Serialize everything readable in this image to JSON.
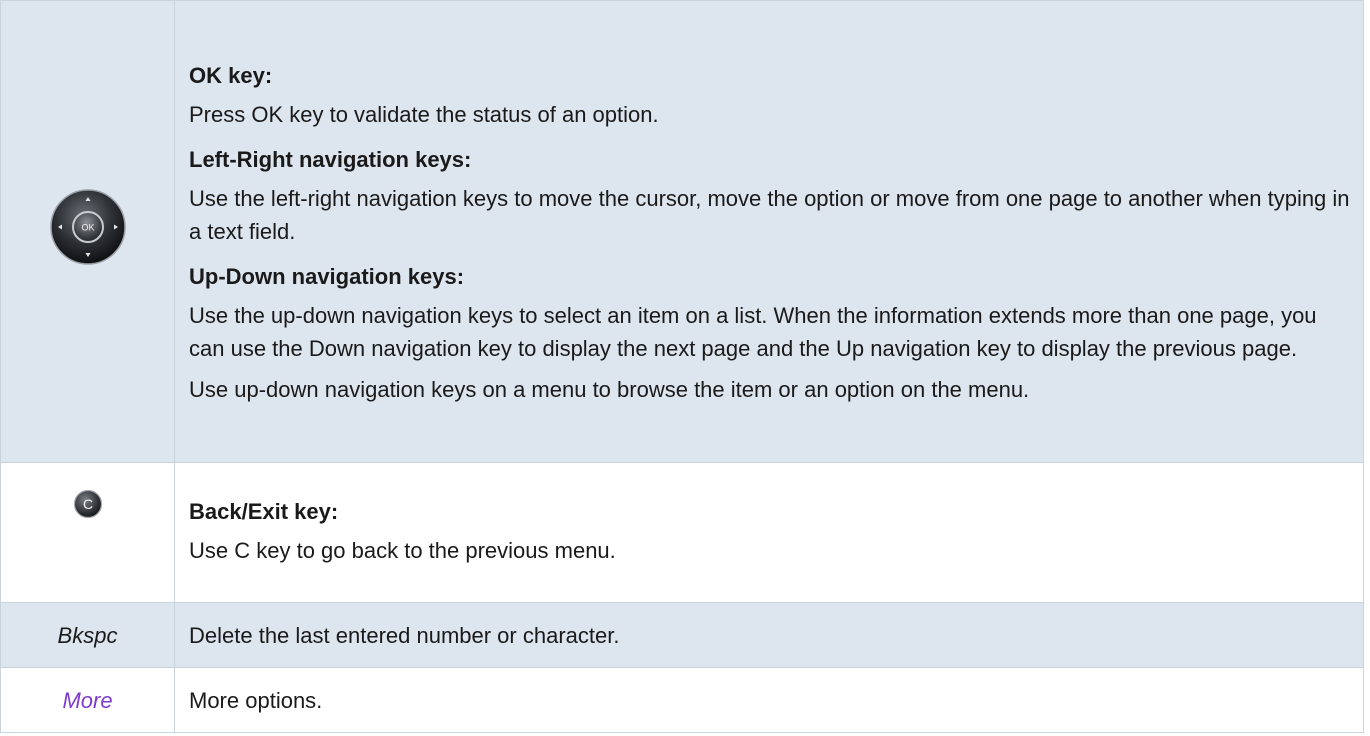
{
  "rows": [
    {
      "icon": "navigation-pad-icon",
      "sections": [
        {
          "heading": "OK key:",
          "paragraphs": [
            "Press OK key to validate the status of an option."
          ]
        },
        {
          "heading": "Left-Right navigation keys:",
          "paragraphs": [
            "Use the left-right navigation keys to move the cursor, move the option or move from one page to another when typing in a text field."
          ]
        },
        {
          "heading": "Up-Down navigation keys:",
          "paragraphs": [
            "Use the up-down navigation keys to select an item on a list. When the information extends more than one page, you can use the Down navigation key to display the next page and the Up navigation key to display the previous page.",
            "Use up-down navigation keys on a menu to browse the item or an option on the menu."
          ]
        }
      ],
      "icon_label": "OK"
    },
    {
      "icon": "c-key-icon",
      "icon_label": "C",
      "sections": [
        {
          "heading": "Back/Exit key:",
          "paragraphs": [
            "Use C key to go back to the previous menu."
          ]
        }
      ]
    },
    {
      "label": "Bkspc",
      "text": "Delete the last entered number or character."
    },
    {
      "label": "More",
      "text": "More options.",
      "label_color": "#7d3ccf"
    }
  ]
}
